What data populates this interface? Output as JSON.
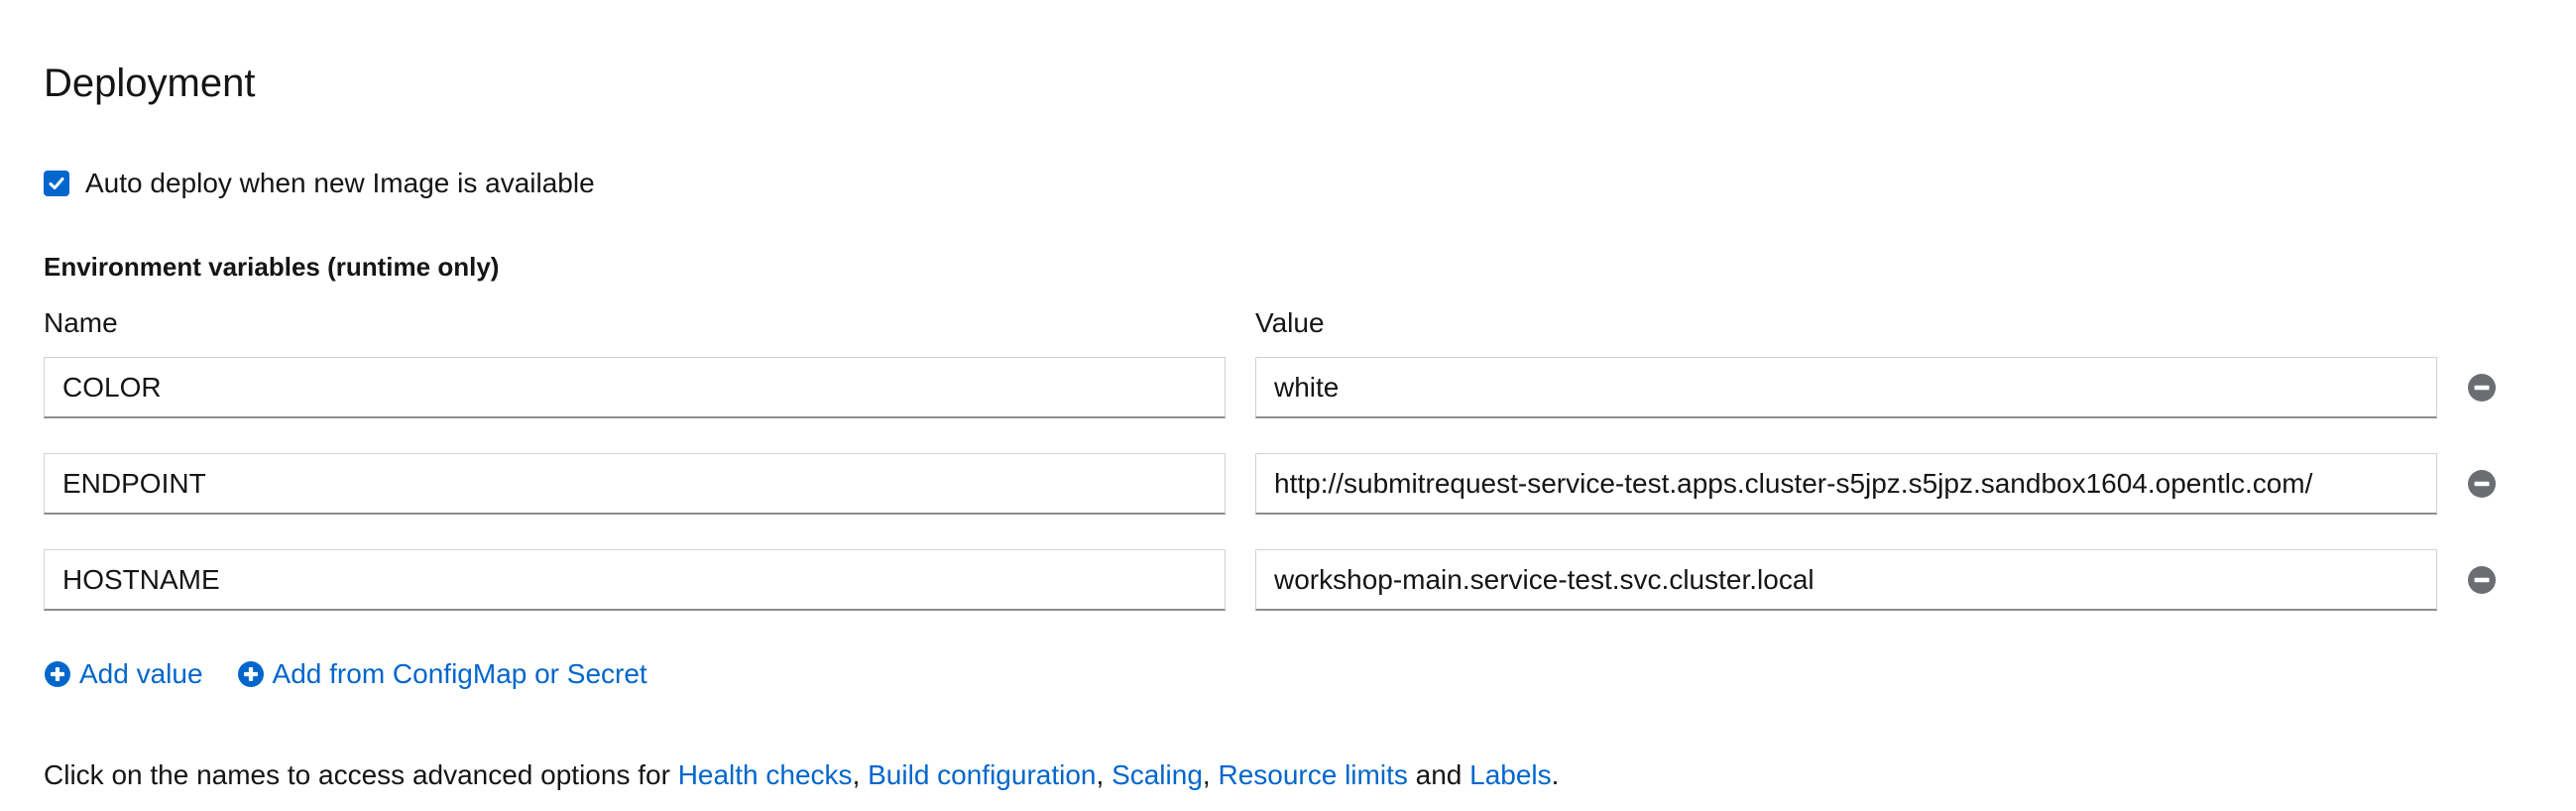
{
  "section": {
    "title": "Deployment"
  },
  "auto_deploy": {
    "label": "Auto deploy when new Image is available",
    "checked": true
  },
  "env": {
    "heading": "Environment variables (runtime only)",
    "name_header": "Name",
    "value_header": "Value",
    "rows": [
      {
        "name": "COLOR",
        "value": "white"
      },
      {
        "name": "ENDPOINT",
        "value": "http://submitrequest-service-test.apps.cluster-s5jpz.s5jpz.sandbox1604.opentlc.com/"
      },
      {
        "name": "HOSTNAME",
        "value": "workshop-main.service-test.svc.cluster.local"
      }
    ],
    "add_value_label": "Add value",
    "add_from_label": "Add from ConfigMap or Secret"
  },
  "footer": {
    "prefix": "Click on the names to access advanced options for ",
    "sep1": ", ",
    "sep2": ", ",
    "sep3": ", ",
    "and_text": " and ",
    "end": ".",
    "links": {
      "health_checks": "Health checks",
      "build_configuration": "Build configuration",
      "scaling": "Scaling",
      "resource_limits": "Resource limits",
      "labels": "Labels"
    }
  },
  "colors": {
    "accent": "#0066cc",
    "text": "#151515",
    "icon_gray": "#6a6e73"
  }
}
